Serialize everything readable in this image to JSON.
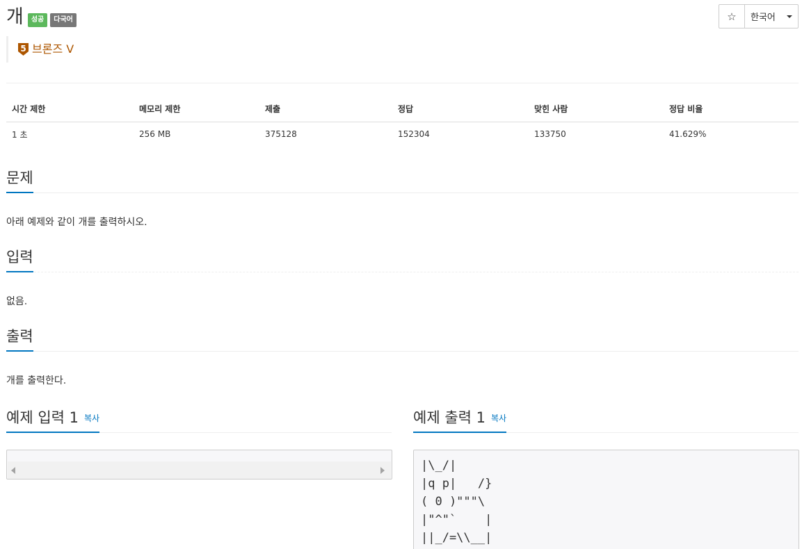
{
  "problem": {
    "title": "개",
    "labels": [
      "성공",
      "다국어"
    ],
    "tier": {
      "name": "브론즈 V",
      "level": "5",
      "color": "#ad5600"
    }
  },
  "toolbar": {
    "star_icon": "star-icon",
    "star_glyph": "☆",
    "language": "한국어"
  },
  "stats": {
    "headers": [
      "시간 제한",
      "메모리 제한",
      "제출",
      "정답",
      "맞힌 사람",
      "정답 비율"
    ],
    "values": [
      "1 초",
      "256 MB",
      "375128",
      "152304",
      "133750",
      "41.629%"
    ]
  },
  "sections": {
    "problem": {
      "title": "문제",
      "body": "아래 예제와 같이 개를 출력하시오."
    },
    "input": {
      "title": "입력",
      "body": "없음."
    },
    "output": {
      "title": "출력",
      "body": "개를 출력한다."
    }
  },
  "samples": {
    "input": {
      "title": "예제 입력 1",
      "copy": "복사",
      "content": ""
    },
    "output": {
      "title": "예제 출력 1",
      "copy": "복사",
      "content": "|\\_/|\n|q p|   /}\n( 0 )\"\"\"\\\n|\"^\"`    |\n||_/=\\\\__|"
    }
  },
  "colors": {
    "accent": "#0076c0",
    "success": "#5cb85c",
    "default_label": "#777777",
    "bronze": "#ad5600"
  }
}
